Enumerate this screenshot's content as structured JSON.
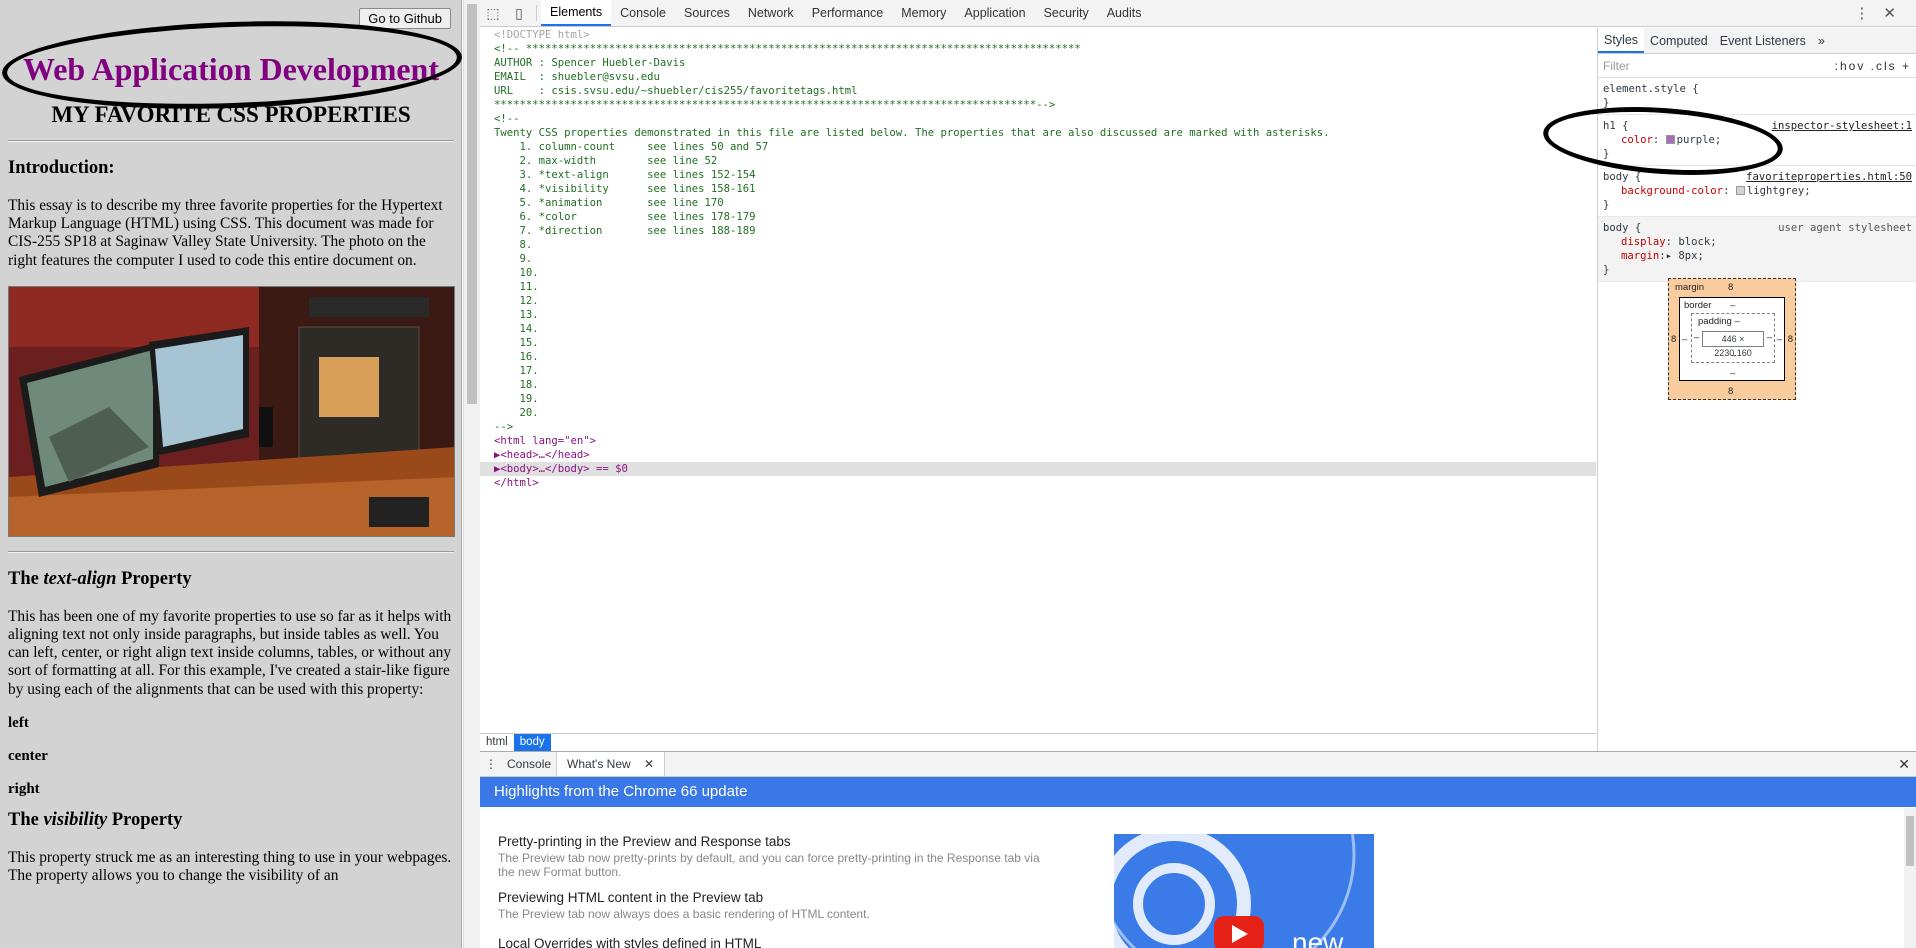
{
  "page": {
    "github_button": "Go to Github",
    "heading": "Web Application Development",
    "subheading": "MY FAVORITE CSS PROPERTIES",
    "intro_title": "Introduction:",
    "intro_text": "This essay is to describe my three favorite properties for the Hypertext Markup Language (HTML) using CSS. This document was made for CIS-255 SP18 at Saginaw Valley State University. The photo on the right features the computer I used to code this entire document on.",
    "section1_title_pre": "The ",
    "section1_title_em": "text-align",
    "section1_title_post": " Property",
    "section1_text": "This has been one of my favorite properties to use so far as it helps with aligning text not only inside paragraphs, but inside tables as well. You can left, center, or right align text inside columns, tables, or without any sort of formatting at all. For this example, I've created a stair-like figure by using each of the alignments that can be used with this property:",
    "align_left": "left",
    "align_center": "center",
    "align_right": "right",
    "section2_title_pre": "The ",
    "section2_title_em": "visibility",
    "section2_title_post": " Property",
    "section2_text": "This property struck me as an interesting thing to use in your webpages. The property allows you to change the visibility of an"
  },
  "devtools": {
    "tabs": [
      "Elements",
      "Console",
      "Sources",
      "Network",
      "Performance",
      "Memory",
      "Application",
      "Security",
      "Audits"
    ],
    "active_tab": "Elements",
    "source_lines": [
      {
        "cls": "c-gray",
        "text": "<!DOCTYPE html>"
      },
      {
        "cls": "c-cmt",
        "text": "<!-- ***************************************************************************************"
      },
      {
        "cls": "c-cmt",
        "text": "AUTHOR : Spencer Huebler-Davis"
      },
      {
        "cls": "c-cmt",
        "text": "EMAIL  : shuebler@svsu.edu"
      },
      {
        "cls": "c-cmt",
        "text": "URL    : csis.svsu.edu/~shuebler/cis255/favoritetags.html"
      },
      {
        "cls": "c-cmt",
        "text": "*************************************************************************************-->"
      },
      {
        "cls": "c-cmt",
        "text": "<!--"
      },
      {
        "cls": "c-cmt",
        "text": "Twenty CSS properties demonstrated in this file are listed below. The properties that are also discussed are marked with asterisks."
      },
      {
        "cls": "c-cmt",
        "text": "    1. column-count     see lines 50 and 57"
      },
      {
        "cls": "c-cmt",
        "text": "    2. max-width        see line 52"
      },
      {
        "cls": "c-cmt",
        "text": "    3. *text-align      see lines 152-154"
      },
      {
        "cls": "c-cmt",
        "text": "    4. *visibility      see lines 158-161"
      },
      {
        "cls": "c-cmt",
        "text": "    5. *animation       see line 170"
      },
      {
        "cls": "c-cmt",
        "text": "    6. *color           see lines 178-179"
      },
      {
        "cls": "c-cmt",
        "text": "    7. *direction       see lines 188-189"
      },
      {
        "cls": "c-cmt",
        "text": "    8."
      },
      {
        "cls": "c-cmt",
        "text": "    9."
      },
      {
        "cls": "c-cmt",
        "text": "    10."
      },
      {
        "cls": "c-cmt",
        "text": "    11."
      },
      {
        "cls": "c-cmt",
        "text": "    12."
      },
      {
        "cls": "c-cmt",
        "text": "    13."
      },
      {
        "cls": "c-cmt",
        "text": "    14."
      },
      {
        "cls": "c-cmt",
        "text": "    15."
      },
      {
        "cls": "c-cmt",
        "text": "    16."
      },
      {
        "cls": "c-cmt",
        "text": "    17."
      },
      {
        "cls": "c-cmt",
        "text": "    18."
      },
      {
        "cls": "c-cmt",
        "text": "    19."
      },
      {
        "cls": "c-cmt",
        "text": "    20."
      },
      {
        "cls": "c-cmt",
        "text": "-->"
      }
    ],
    "html_open": "<html lang=\"en\">",
    "head_line": "▶<head>…</head>",
    "body_line": "▶<body>…</body> == $0",
    "html_close": "</html>",
    "breadcrumbs": [
      "html",
      "body"
    ],
    "styles_tabs": [
      "Styles",
      "Computed",
      "Event Listeners",
      "»"
    ],
    "filter_placeholder": "Filter",
    "filter_tools": ":hov .cls +",
    "element_style": "element.style {",
    "rules": [
      {
        "selector": "h1 {",
        "source": "inspector-stylesheet:1",
        "prop": "color",
        "value": "purple;",
        "swatch": "#a86cbf"
      },
      {
        "selector": "body {",
        "source": "favoriteproperties.html:50",
        "prop": "background-color",
        "value": "lightgrey;",
        "swatch": "#d3d3d3"
      },
      {
        "selector": "body {",
        "source": "user agent stylesheet",
        "prop": "display",
        "value": "block;",
        "prop2": "margin",
        "value2": "8px;"
      }
    ],
    "box_model": {
      "margin_label": "margin",
      "margin_top": "8",
      "margin_bottom": "8",
      "margin_left": "8",
      "margin_right": "8",
      "border_label": "border",
      "border_val": "–",
      "padding_label": "padding –",
      "content": "446 × 2230.160",
      "dash": "–"
    },
    "drawer": {
      "tabs": [
        "Console",
        "What's New"
      ],
      "header": "Highlights from the Chrome 66 update",
      "items": [
        {
          "title": "Pretty-printing in the Preview and Response tabs",
          "desc": "The Preview tab now pretty-prints by default, and you can force pretty-printing in the Response tab via the new Format button."
        },
        {
          "title": "Previewing HTML content in the Preview tab",
          "desc": "The Preview tab now always does a basic rendering of HTML content."
        },
        {
          "title": "Local Overrides with styles defined in HTML",
          "desc": ""
        }
      ],
      "video_label": "new"
    }
  },
  "colors": {
    "heading": "#800080",
    "page_bg": "#d3d3d3",
    "accent": "#1a73e8",
    "whatsnew_bar": "#3b78e7"
  }
}
